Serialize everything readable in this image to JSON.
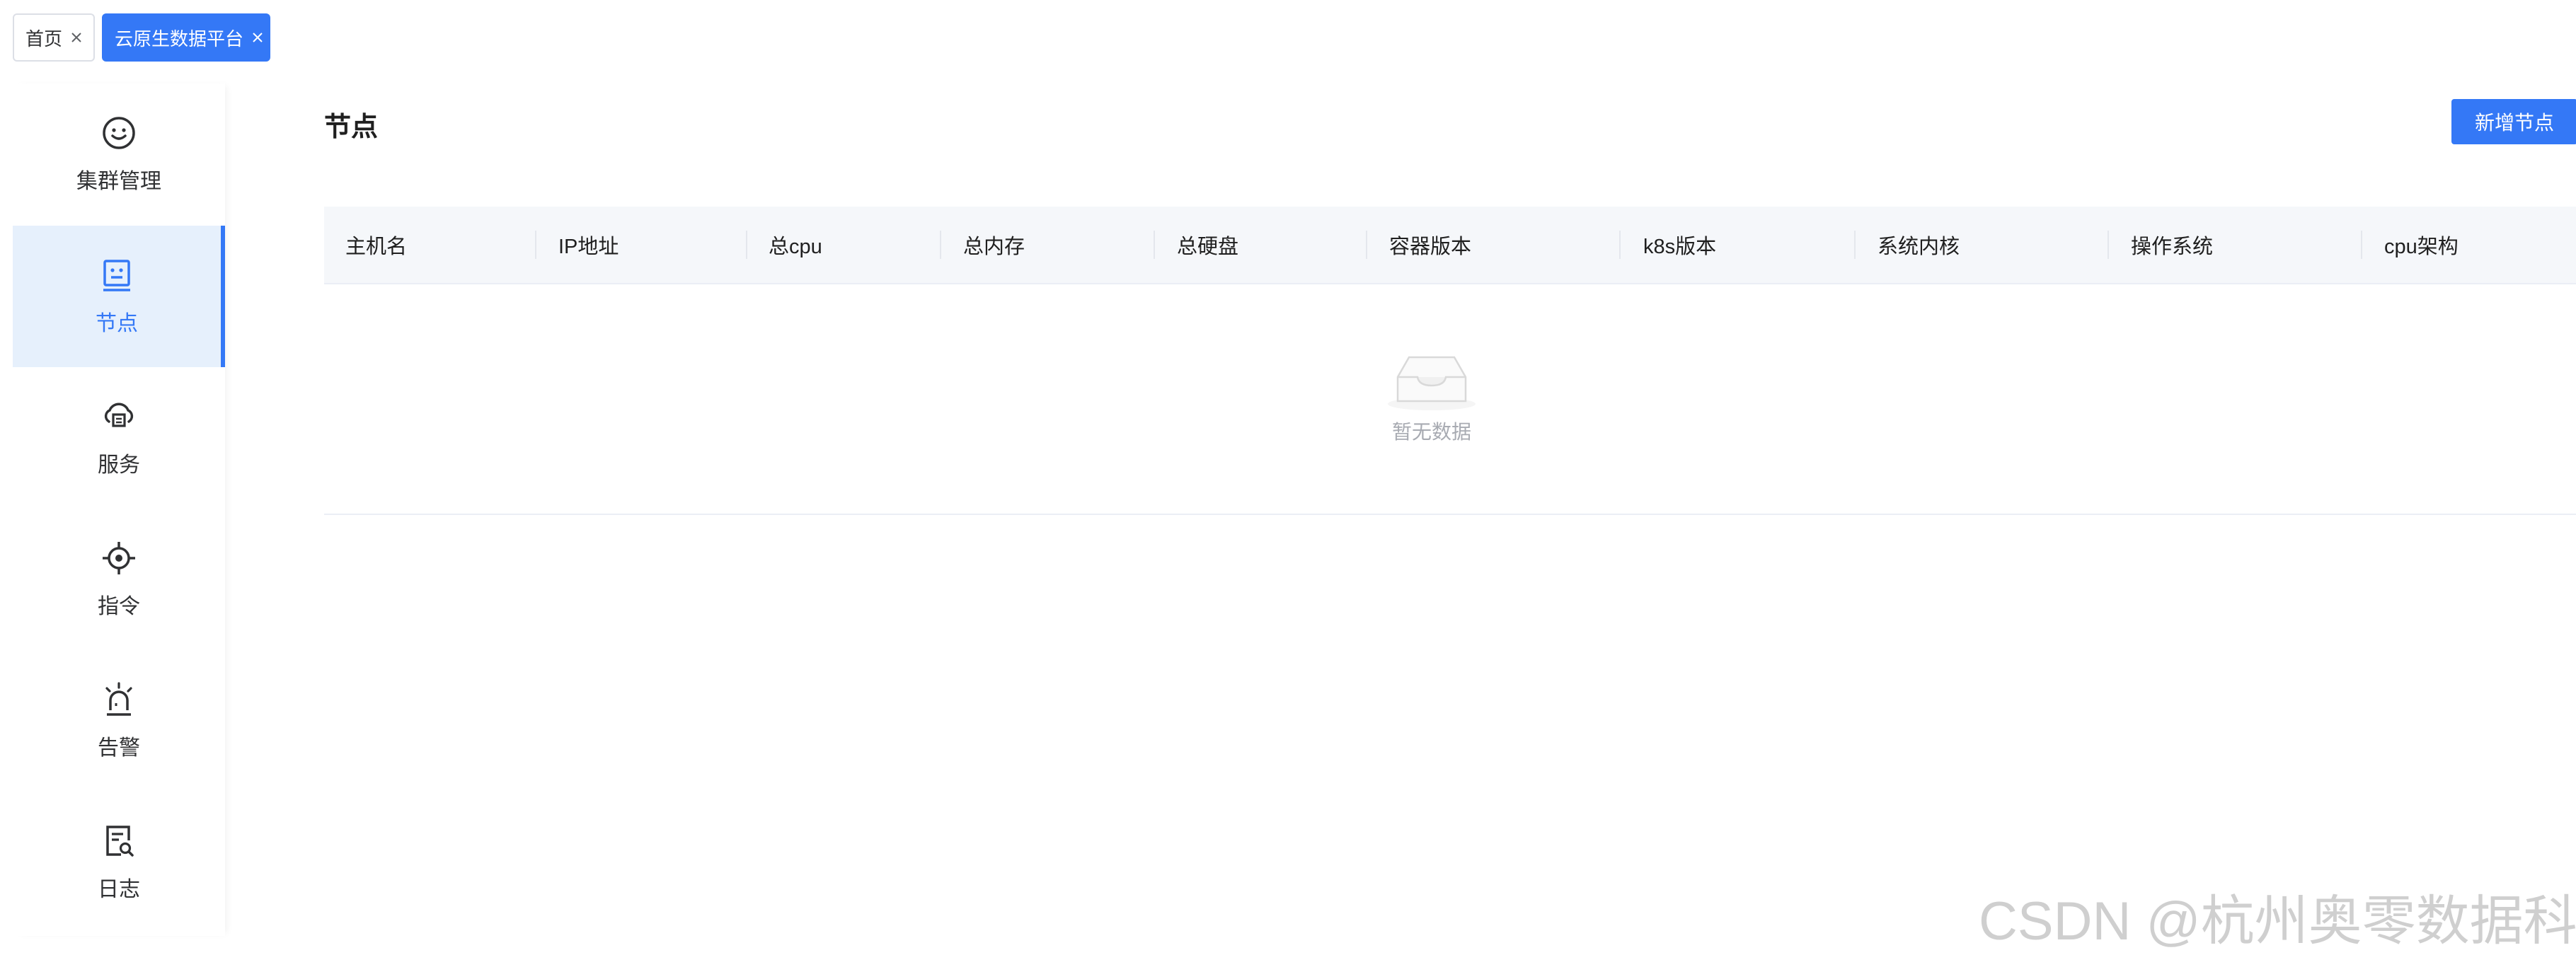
{
  "tabs": [
    {
      "label": "首页",
      "active": false
    },
    {
      "label": "云原生数据平台",
      "active": true
    }
  ],
  "sidebar": {
    "items": [
      {
        "label": "集群管理",
        "icon": "smiley-icon",
        "active": false
      },
      {
        "label": "节点",
        "icon": "server-node-icon",
        "active": true
      },
      {
        "label": "服务",
        "icon": "cloud-service-icon",
        "active": false
      },
      {
        "label": "指令",
        "icon": "crosshair-icon",
        "active": false
      },
      {
        "label": "告警",
        "icon": "alarm-siren-icon",
        "active": false
      },
      {
        "label": "日志",
        "icon": "log-search-icon",
        "active": false
      }
    ]
  },
  "main": {
    "title": "节点",
    "add_button_label": "新增节点"
  },
  "table": {
    "columns": [
      "主机名",
      "IP地址",
      "总cpu",
      "总内存",
      "总硬盘",
      "容器版本",
      "k8s版本",
      "系统内核",
      "操作系统",
      "cpu架构"
    ],
    "rows": [],
    "empty_text": "暂无数据"
  },
  "watermark": "CSDN @杭州奥零数据科技",
  "colors": {
    "accent": "#3478f6",
    "active_bg": "#e6f0fc",
    "header_bg": "#f5f7fa",
    "empty_text": "#a8abb2"
  }
}
